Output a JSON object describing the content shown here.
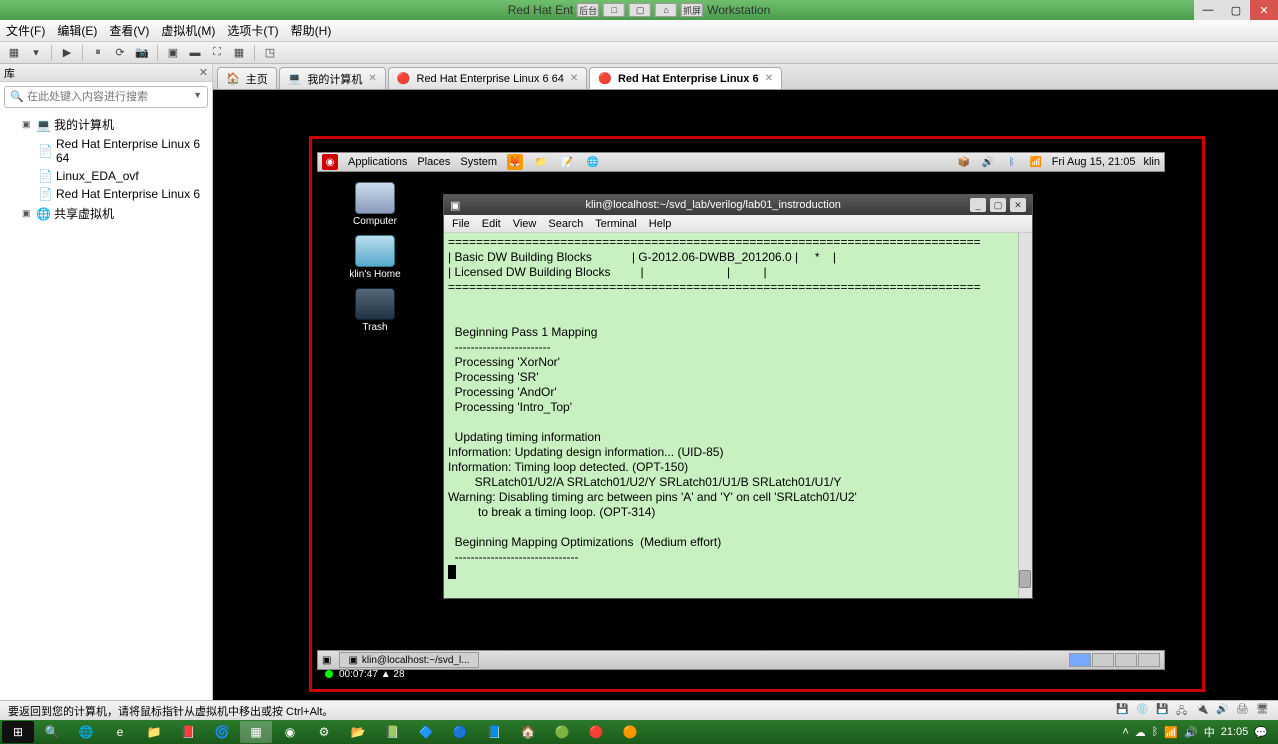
{
  "host_title_left": "Red Hat Ent",
  "host_title_right": "Workstation",
  "host_inline_btns": [
    "后台",
    "□",
    "▢",
    "⌂",
    "抓屏"
  ],
  "vm_menus": [
    "文件(F)",
    "编辑(E)",
    "查看(V)",
    "虚拟机(M)",
    "选项卡(T)",
    "帮助(H)"
  ],
  "sidebar_title": "库",
  "search_placeholder": "在此处键入内容进行搜索",
  "tree": {
    "root": "我的计算机",
    "children": [
      "Red Hat Enterprise Linux 6 64",
      "Linux_EDA_ovf",
      "Red Hat Enterprise Linux 6"
    ],
    "shared": "共享虚拟机"
  },
  "tabs": [
    {
      "label": "主页",
      "icon": "🏠"
    },
    {
      "label": "我的计算机",
      "icon": "💻"
    },
    {
      "label": "Red Hat Enterprise Linux 6 64",
      "icon": "🔴"
    },
    {
      "label": "Red Hat Enterprise Linux 6",
      "icon": "🔴",
      "active": true
    }
  ],
  "gnome_top": {
    "menus": [
      "Applications",
      "Places",
      "System"
    ],
    "clock": "Fri Aug 15, 21:05",
    "user": "klin"
  },
  "desktop_icons": [
    "Computer",
    "klin's Home",
    "Trash"
  ],
  "terminal": {
    "title": "klin@localhost:~/svd_lab/verilog/lab01_instroduction",
    "menus": [
      "File",
      "Edit",
      "View",
      "Search",
      "Terminal",
      "Help"
    ],
    "lines": [
      "============================================================================",
      "| Basic DW Building Blocks            | G-2012.06-DWBB_201206.0 |     *    |",
      "| Licensed DW Building Blocks         |                         |          |",
      "============================================================================",
      "",
      "",
      "  Beginning Pass 1 Mapping",
      "  ------------------------",
      "  Processing 'XorNor'",
      "  Processing 'SR'",
      "  Processing 'AndOr'",
      "  Processing 'Intro_Top'",
      "",
      "  Updating timing information",
      "Information: Updating design information... (UID-85)",
      "Information: Timing loop detected. (OPT-150)",
      "        SRLatch01/U2/A SRLatch01/U2/Y SRLatch01/U1/B SRLatch01/U1/Y",
      "Warning: Disabling timing arc between pins 'A' and 'Y' on cell 'SRLatch01/U2'",
      "         to break a timing loop. (OPT-314)",
      "",
      "  Beginning Mapping Optimizations  (Medium effort)",
      "  -------------------------------"
    ]
  },
  "gnome_bottom_task": "klin@localhost:~/svd_l...",
  "vm_record": "00:07:47 ▲ 28",
  "status_msg": "要返回到您的计算机，请将鼠标指针从虚拟机中移出或按 Ctrl+Alt。",
  "win_clock": "21:05"
}
